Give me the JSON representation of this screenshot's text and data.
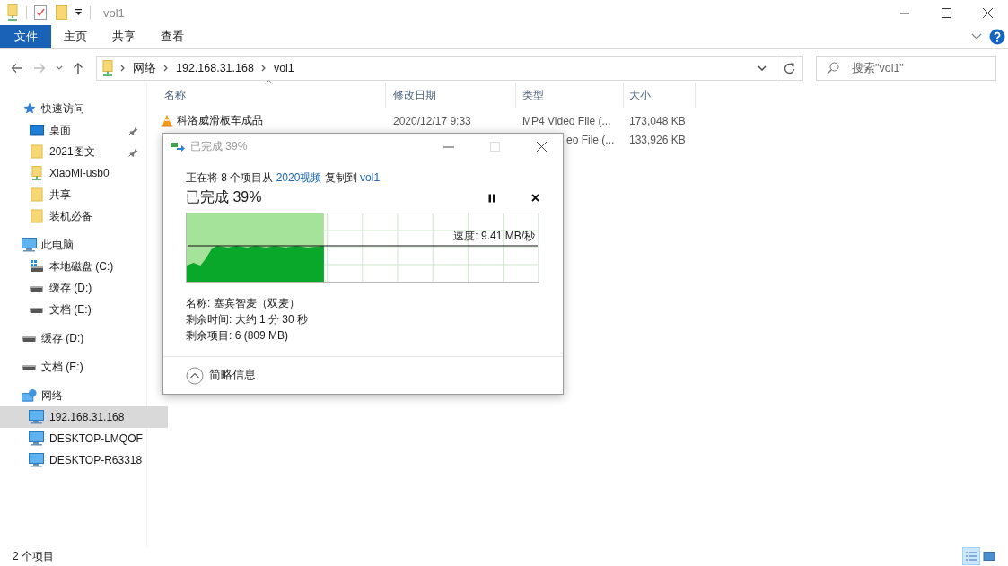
{
  "window": {
    "title": "vol1"
  },
  "ribbon": {
    "tabs": [
      {
        "label": "文件",
        "kind": "file-menu"
      },
      {
        "label": "主页",
        "kind": "tab"
      },
      {
        "label": "共享",
        "kind": "tab"
      },
      {
        "label": "查看",
        "kind": "tab"
      }
    ]
  },
  "address_bar": {
    "crumbs": [
      "网络",
      "192.168.31.168",
      "vol1"
    ]
  },
  "search": {
    "placeholder": "搜索\"vol1\""
  },
  "nav_pane": {
    "items": [
      {
        "label": "快速访问",
        "kind": "star",
        "selected": false,
        "children": [
          {
            "label": "桌面",
            "kind": "desktop",
            "pinned": true,
            "selected": false
          },
          {
            "label": "2021图文",
            "kind": "folder",
            "pinned": true,
            "selected": false
          },
          {
            "label": "XiaoMi-usb0",
            "kind": "network-folder",
            "pinned": false,
            "selected": false
          },
          {
            "label": "共享",
            "kind": "folder",
            "pinned": false,
            "selected": false
          },
          {
            "label": "装机必备",
            "kind": "folder",
            "pinned": false,
            "selected": false
          }
        ]
      },
      {
        "label": "此电脑",
        "kind": "pc",
        "selected": false,
        "children": [
          {
            "label": "本地磁盘 (C:)",
            "kind": "system-drive",
            "selected": false
          },
          {
            "label": "缓存 (D:)",
            "kind": "drive",
            "selected": false
          },
          {
            "label": "文档 (E:)",
            "kind": "drive",
            "selected": false
          }
        ]
      },
      {
        "label": "缓存 (D:)",
        "kind": "drive",
        "selected": false
      },
      {
        "label": "文档 (E:)",
        "kind": "drive",
        "selected": false
      },
      {
        "label": "网络",
        "kind": "network",
        "selected": false,
        "children": [
          {
            "label": "192.168.31.168",
            "kind": "pc",
            "selected": true
          },
          {
            "label": "DESKTOP-LMQOF",
            "kind": "pc",
            "selected": false
          },
          {
            "label": "DESKTOP-R63318",
            "kind": "pc",
            "selected": false
          }
        ]
      }
    ]
  },
  "file_list": {
    "columns": [
      "名称",
      "修改日期",
      "类型",
      "大小"
    ],
    "rows": [
      {
        "kind": "full",
        "name": "科洛威滑板车成品",
        "modified": "2020/12/17 9:33",
        "type": "MP4 Video File (...",
        "size": "173,048 KB"
      },
      {
        "kind": "partly-covered",
        "type": "eo File (...",
        "size": "133,926 KB"
      }
    ]
  },
  "copy_dialog": {
    "title": "已完成 39%",
    "message": [
      {
        "kind": "text",
        "text": "正在将 8 个项目从 "
      },
      {
        "kind": "link",
        "text": "2020视频"
      },
      {
        "kind": "text",
        "text": " 复制到 "
      },
      {
        "kind": "link",
        "text": "vol1"
      }
    ],
    "heading": "已完成 39%",
    "level": 0.39,
    "speed": "速度: 9.41 MB/秒",
    "details": [
      "名称: 塞宾智麦（双麦）",
      "剩余时间: 大约 1 分 30 秒",
      "剩余项目: 6 (809 MB)"
    ],
    "toggle": "简略信息"
  },
  "status_bar": {
    "count": "2 个项目",
    "views": [
      {
        "kind": "details",
        "selected": true
      },
      {
        "kind": "large-icons",
        "selected": false
      }
    ]
  }
}
